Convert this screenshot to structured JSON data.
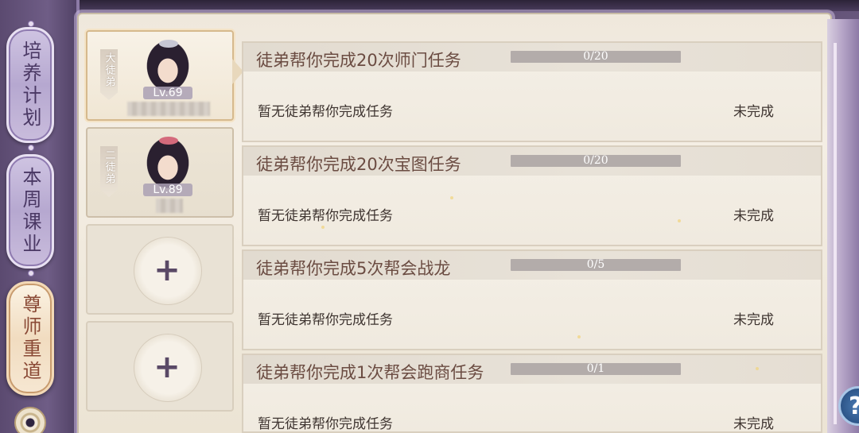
{
  "tabs": [
    {
      "label": "培养计划",
      "state": "inactive"
    },
    {
      "label": "本周课业",
      "state": "inactive"
    },
    {
      "label": "尊师重道",
      "state": "active"
    }
  ],
  "disciples": [
    {
      "rank": "大徒弟",
      "level": "Lv.69",
      "selected": true
    },
    {
      "rank": "二徒弟",
      "level": "Lv.89",
      "selected": false
    }
  ],
  "empty_slots": [
    {
      "icon": "plus-icon"
    },
    {
      "icon": "plus-icon"
    }
  ],
  "tasks": [
    {
      "title": "徒弟帮你完成20次师门任务",
      "progress_text": "0/20",
      "progress": 0,
      "description": "暂无徒弟帮你完成任务",
      "status": "未完成"
    },
    {
      "title": "徒弟帮你完成20次宝图任务",
      "progress_text": "0/20",
      "progress": 0,
      "description": "暂无徒弟帮你完成任务",
      "status": "未完成"
    },
    {
      "title": "徒弟帮你完成5次帮会战龙",
      "progress_text": "0/5",
      "progress": 0,
      "description": "暂无徒弟帮你完成任务",
      "status": "未完成"
    },
    {
      "title": "徒弟帮你完成1次帮会跑商任务",
      "progress_text": "0/1",
      "progress": 0,
      "description": "暂无徒弟帮你完成任务",
      "status": "未完成"
    }
  ],
  "help": {
    "icon": "question-icon",
    "label": "?"
  },
  "colors": {
    "tab_inactive": "#b6a8d0",
    "tab_active": "#f1dcc0",
    "task_title": "#6b4c42",
    "progress_track": "#b3acaa"
  }
}
